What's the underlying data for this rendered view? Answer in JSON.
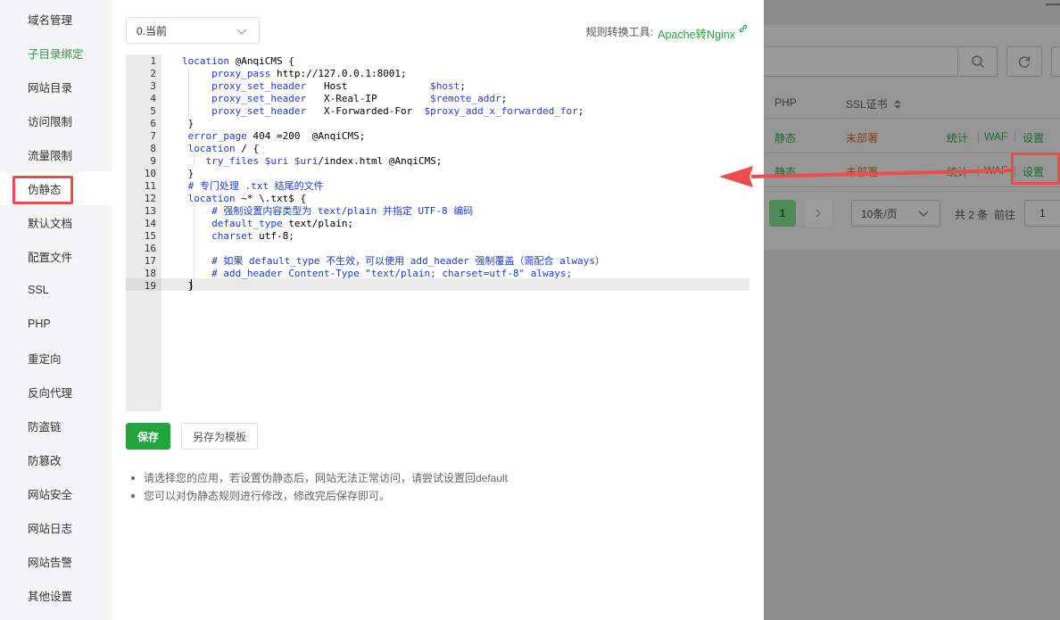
{
  "sidebar": {
    "items": [
      {
        "label": "域名管理"
      },
      {
        "label": "子目录绑定"
      },
      {
        "label": "网站目录"
      },
      {
        "label": "访问限制"
      },
      {
        "label": "流量限制"
      },
      {
        "label": "伪静态"
      },
      {
        "label": "默认文档"
      },
      {
        "label": "配置文件"
      },
      {
        "label": "SSL"
      },
      {
        "label": "PHP"
      },
      {
        "label": "重定向"
      },
      {
        "label": "反向代理"
      },
      {
        "label": "防盗链"
      },
      {
        "label": "防篡改"
      },
      {
        "label": "网站安全"
      },
      {
        "label": "网站日志"
      },
      {
        "label": "网站告警"
      },
      {
        "label": "其他设置"
      }
    ],
    "active_label": "子目录绑定",
    "selected_label": "伪静态"
  },
  "main": {
    "template_select": {
      "value": "0.当前"
    },
    "tool_label": "规则转换工具:",
    "tool_link": "Apache转Nginx",
    "editor": {
      "line_numbers": [
        "1",
        "2",
        "3",
        "4",
        "5",
        "6",
        "7",
        "8",
        "9",
        "10",
        "11",
        "12",
        "13",
        "14",
        "15",
        "16",
        "17",
        "18",
        "19"
      ],
      "active_line": 19
    },
    "save_button": "保存",
    "save_template_button": "另存为模板",
    "tips": [
      "请选择您的应用，若设置伪静态后，网站无法正常访问，请尝试设置回default",
      "您可以对伪静态规则进行修改，修改完后保存即可。"
    ]
  },
  "background_list": {
    "columns": {
      "php": "PHP",
      "ssl": "SSL证书"
    },
    "rows": [
      {
        "php": "静态",
        "ssl": "未部署",
        "actions": [
          "统计",
          "WAF",
          "设置"
        ]
      },
      {
        "php": "静态",
        "ssl": "未部署",
        "actions": [
          "统计",
          "WAF",
          "设置"
        ]
      }
    ],
    "pagination": {
      "current": "1",
      "page_size": "10条/页",
      "total": "共 2 条",
      "goto_label": "前往",
      "goto_value": "1"
    }
  },
  "colors": {
    "accent": "#20a53a",
    "highlight": "#ee4b4b"
  }
}
